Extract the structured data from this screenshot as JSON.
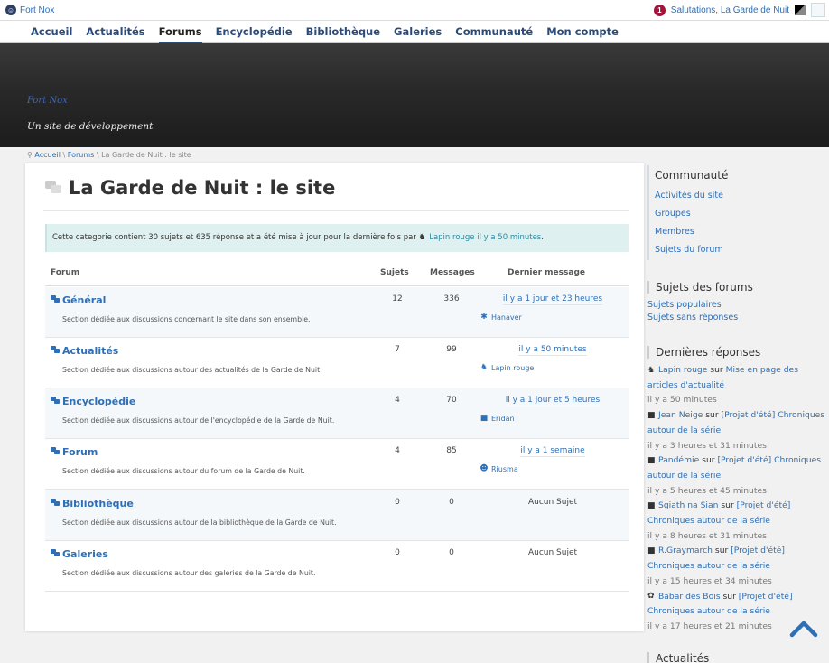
{
  "adminbar": {
    "site_name": "Fort Nox",
    "notification_count": "1",
    "greeting": "Salutations, La Garde de Nuit"
  },
  "nav": {
    "items": [
      "Accueil",
      "Actualités",
      "Forums",
      "Encyclopédie",
      "Bibliothèque",
      "Galeries",
      "Communauté",
      "Mon compte"
    ],
    "active": "Forums"
  },
  "banner": {
    "site_title": "Fort Nox",
    "tagline": "Un site de développement"
  },
  "breadcrumb": {
    "home": "Accueil",
    "sep": " \\ ",
    "forums": "Forums",
    "current": "La Garde de Nuit : le site"
  },
  "page": {
    "title": "La Garde de Nuit : le site",
    "notice_text": "Cette categorie contient 30 sujets et 635 réponse et a été mise à jour pour la dernière fois par",
    "notice_user": "Lapin rouge",
    "notice_time": "il y a 50 minutes",
    "notice_end": "."
  },
  "table": {
    "col_forum": "Forum",
    "col_topics": "Sujets",
    "col_posts": "Messages",
    "col_last": "Dernier message",
    "rows": [
      {
        "name": "Général",
        "desc": "Section dédiée aux discussions concernant le site dans son ensemble.",
        "topics": "12",
        "posts": "336",
        "last": "il y a 1 jour et 23 heures",
        "author": "Hanaver",
        "avatar": "✱"
      },
      {
        "name": "Actualités",
        "desc": "Section dédiée aux discussions autour des actualités de la Garde de Nuit.",
        "topics": "7",
        "posts": "99",
        "last": "il y a 50 minutes",
        "author": "Lapin rouge",
        "avatar": "♞"
      },
      {
        "name": "Encyclopédie",
        "desc": "Section dédiée aux discussions autour de l'encyclopédie de la Garde de Nuit.",
        "topics": "4",
        "posts": "70",
        "last": "il y a 1 jour et 5 heures",
        "author": "Eridan",
        "avatar": "■"
      },
      {
        "name": "Forum",
        "desc": "Section dédiée aux discussions autour du forum de la Garde de Nuit.",
        "topics": "4",
        "posts": "85",
        "last": "il y a 1 semaine",
        "author": "Riusma",
        "avatar": "☻"
      },
      {
        "name": "Bibliothèque",
        "desc": "Section dédiée aux discussions autour de la bibliothèque de la Garde de Nuit.",
        "topics": "0",
        "posts": "0",
        "last": "Aucun Sujet",
        "author": "",
        "avatar": ""
      },
      {
        "name": "Galeries",
        "desc": "Section dédiée aux discussions autour des galeries de la Garde de Nuit.",
        "topics": "0",
        "posts": "0",
        "last": "Aucun Sujet",
        "author": "",
        "avatar": ""
      }
    ]
  },
  "sidebar": {
    "community": {
      "title": "Communauté",
      "links": [
        "Activités du site",
        "Groupes",
        "Membres",
        "Sujets du forum"
      ]
    },
    "forum_topics": {
      "title": "Sujets des forums",
      "links": [
        "Sujets populaires",
        "Sujets sans réponses"
      ]
    },
    "latest": {
      "title": "Dernières réponses",
      "on": "sur",
      "items": [
        {
          "user": "Lapin rouge",
          "topic": "Mise en page des articles d'actualité",
          "ago": "il y a 50 minutes",
          "avatar": "♞"
        },
        {
          "user": "Jean Neige",
          "topic": "[Projet d'été] Chroniques autour de la série",
          "ago": "il y a 3 heures et 31 minutes",
          "avatar": "■"
        },
        {
          "user": "Pandémie",
          "topic": "[Projet d'été] Chroniques autour de la série",
          "ago": "il y a 5 heures et 45 minutes",
          "avatar": "■"
        },
        {
          "user": "Sgiath na Sian",
          "topic": "[Projet d'été] Chroniques autour de la série",
          "ago": "il y a 8 heures et 31 minutes",
          "avatar": "■"
        },
        {
          "user": "R.Graymarch",
          "topic": "[Projet d'été] Chroniques autour de la série",
          "ago": "il y a 15 heures et 34 minutes",
          "avatar": "■"
        },
        {
          "user": "Babar des Bois",
          "topic": "[Projet d'été] Chroniques autour de la série",
          "ago": "il y a 17 heures et 21 minutes",
          "avatar": "✿"
        }
      ]
    },
    "news": {
      "title": "Actualités"
    }
  },
  "icons": {
    "site": "site-icon",
    "back_to_top": "chevron-up-icon",
    "forum": "forum-icon"
  },
  "colors": {
    "link": "#2e6fb5",
    "nav": "#2b4b7a",
    "notification": "#a3133c",
    "notice_bg": "#dff0f0"
  }
}
